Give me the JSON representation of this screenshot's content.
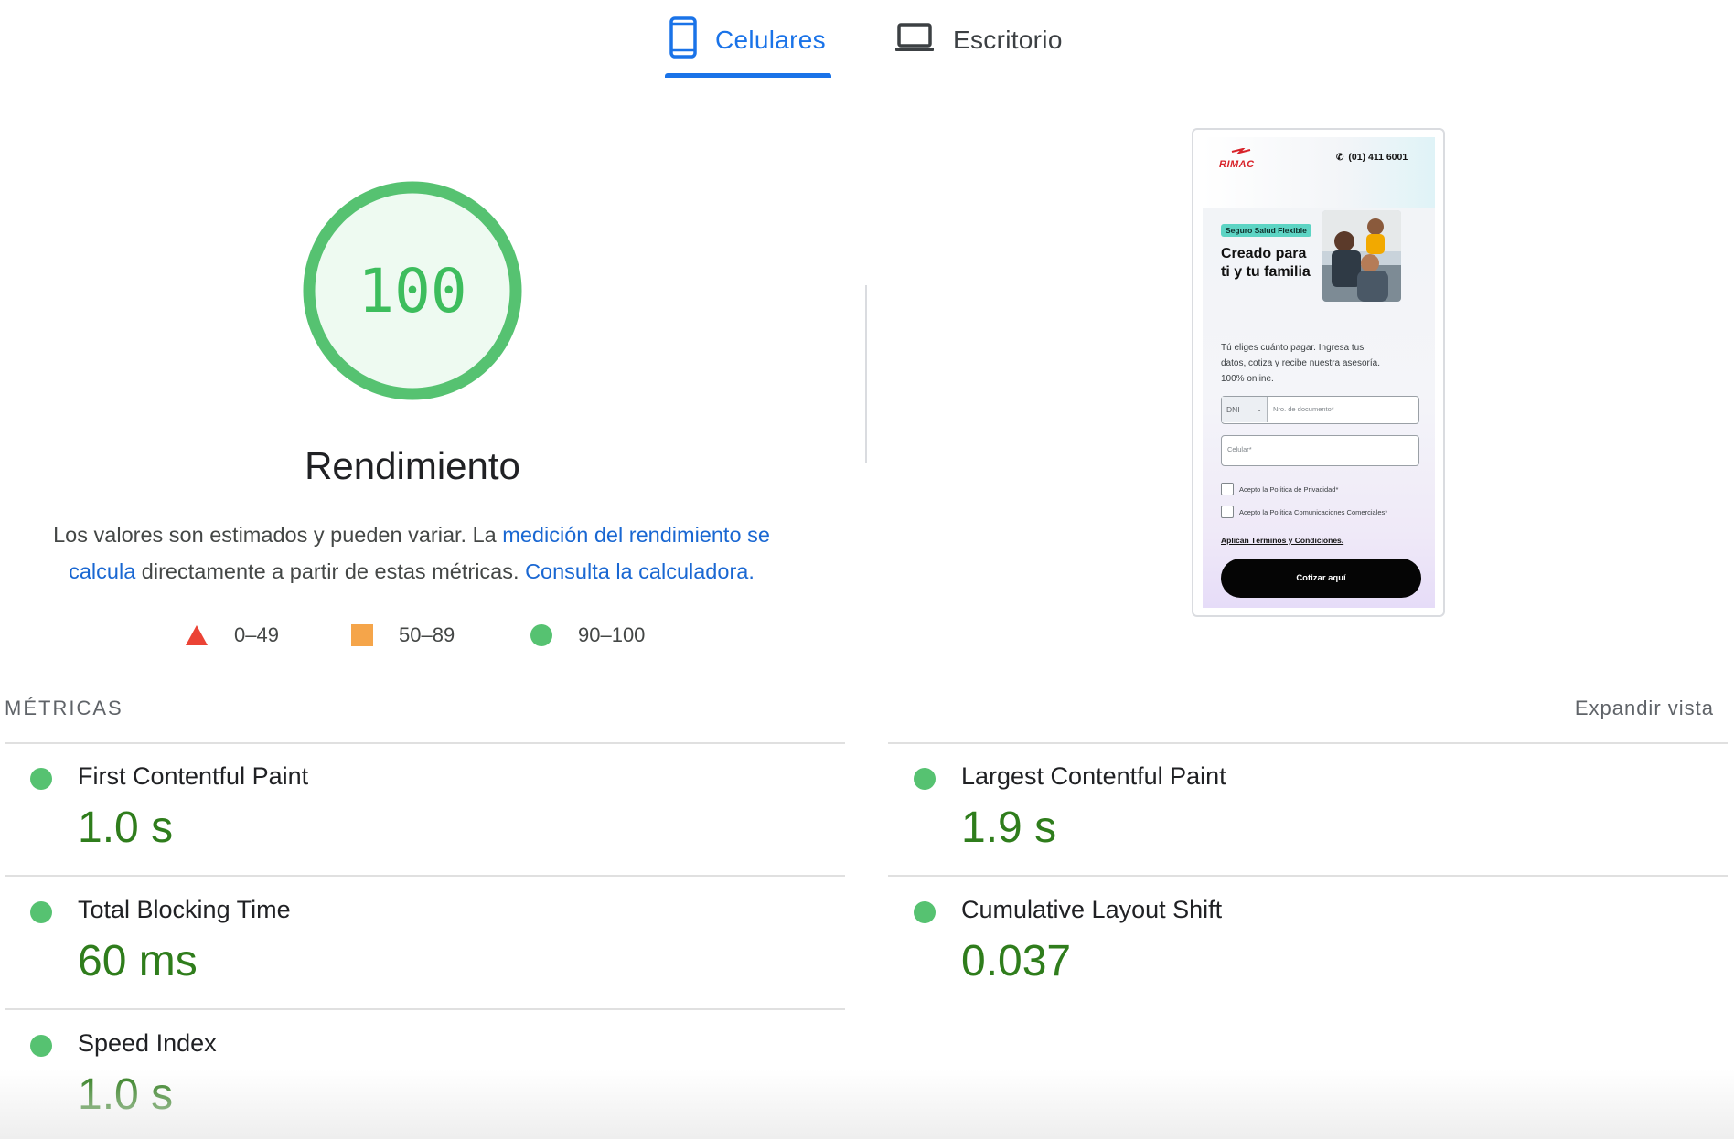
{
  "tabs": {
    "mobile": {
      "label": "Celulares",
      "icon": "smartphone-icon"
    },
    "desktop": {
      "label": "Escritorio",
      "icon": "laptop-icon"
    }
  },
  "gauge": {
    "score": "100",
    "title": "Rendimiento",
    "color": "#56c271"
  },
  "description": {
    "text1": "Los valores son estimados y pueden variar. La ",
    "link1": "medición del rendimiento se calcula",
    "text2": " directamente a partir de estas métricas. ",
    "link2": "Consulta la calculadora."
  },
  "legend": [
    {
      "range": "0–49",
      "shape": "triangle",
      "color": "#eb4335"
    },
    {
      "range": "50–89",
      "shape": "square",
      "color": "#f5a54a"
    },
    {
      "range": "90–100",
      "shape": "circle",
      "color": "#56c271"
    }
  ],
  "thumbnail": {
    "logo": "RIMAC",
    "phone": "(01) 411 6001",
    "badge": "Seguro Salud Flexible",
    "headline1": "Creado para",
    "headline2": "ti y tu familia",
    "body1": "Tú eliges cuánto pagar. Ingresa tus",
    "body2": "datos, cotiza y recibe nuestra asesoría.",
    "body3": "100% online.",
    "doc_type": "DNI",
    "doc_placeholder": "Nro. de documento*",
    "phone_placeholder": "Celular*",
    "check1": "Acepto la Política de Privacidad*",
    "check2": "Acepto la Política Comunicaciones Comerciales*",
    "terms": "Aplican Términos y Condiciones.",
    "cta": "Cotizar aquí"
  },
  "metrics": {
    "heading": "MÉTRICAS",
    "expand": "Expandir vista",
    "items": [
      {
        "name": "First Contentful Paint",
        "value": "1.0 s"
      },
      {
        "name": "Largest Contentful Paint",
        "value": "1.9 s"
      },
      {
        "name": "Total Blocking Time",
        "value": "60 ms"
      },
      {
        "name": "Cumulative Layout Shift",
        "value": "0.037"
      },
      {
        "name": "Speed Index",
        "value": "1.0 s"
      }
    ]
  }
}
